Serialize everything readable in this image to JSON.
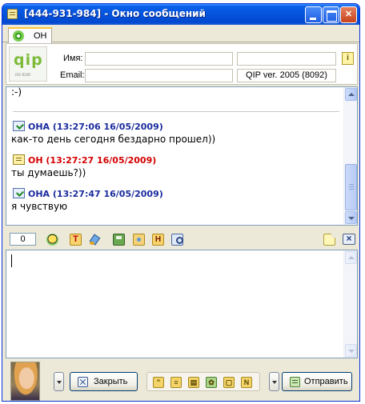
{
  "window": {
    "title": "[444-931-984] - Окно сообщений",
    "controls": [
      "minimize-icon",
      "maximize-icon",
      "close-icon"
    ]
  },
  "tabs": [
    {
      "label": "ОН",
      "icon": "flower-status-icon",
      "active": true
    }
  ],
  "contact_info": {
    "logo_text": "qip",
    "logo_sub": "no icon",
    "name_label": "Имя:",
    "email_label": "Email:",
    "name_value": "",
    "email_value": "",
    "client_value": "",
    "client_version": "QIP ver. 2005 (8092)"
  },
  "history": {
    "partial_line": ":-)",
    "messages": [
      {
        "author": "ОНА",
        "timestamp": "13:27:06 16/05/2009",
        "header": "ОНА (13:27:06 16/05/2009)",
        "text": "как-то день сегодня бездарно прошел))",
        "color": "#1a2c9e"
      },
      {
        "author": "ОН",
        "timestamp": "13:27:27 16/05/2009",
        "header": "ОН (13:27:27 16/05/2009)",
        "text": "ты думаешь?))",
        "color": "#d40000"
      },
      {
        "author": "ОНА",
        "timestamp": "13:27:47 16/05/2009",
        "header": "ОНА (13:27:47 16/05/2009)",
        "text": "я чувствую",
        "color": "#1a2c9e"
      }
    ]
  },
  "toolbar": {
    "char_count": "0",
    "icons": [
      "smiley-icon",
      "font-icon",
      "color-icon",
      "save-icon",
      "image-folder-icon",
      "history-icon",
      "find-icon",
      "note-icon",
      "close-toolbar-icon"
    ],
    "font_glyph": "T",
    "history_glyph": "H",
    "close_glyph": "×"
  },
  "input": {
    "value": ""
  },
  "bottom": {
    "close_label": "Закрыть",
    "send_label": "Отправить",
    "quick_icons": [
      "quote-icon",
      "list-icon",
      "contact-card-icon",
      "invite-icon",
      "copy-icon",
      "notes-n-icon"
    ],
    "n_glyph": "N"
  },
  "colors": {
    "titlebar": "#0553dc",
    "her_name": "#1a2c9e",
    "his_name": "#d40000",
    "window_bg": "#ece9d8"
  }
}
